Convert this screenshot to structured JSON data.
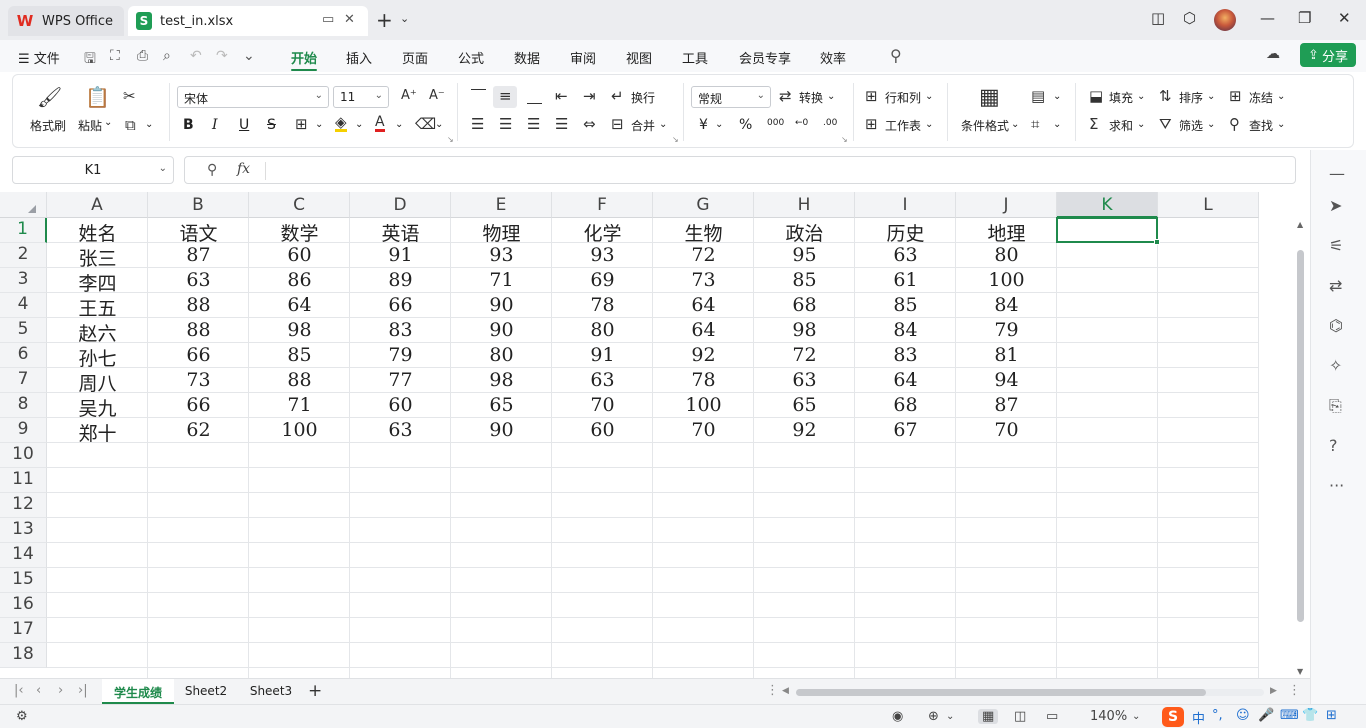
{
  "titlebar": {
    "home_tab_label": "WPS Office",
    "home_logo": "W",
    "file_tab_label": "test_in.xlsx",
    "file_logo": "S",
    "new_tab": "+",
    "icons": [
      "layout-icon",
      "cube-icon",
      "avatar",
      "minimize-icon",
      "restore-icon",
      "close-icon"
    ]
  },
  "menubar": {
    "file_menu": "☰ 文件",
    "tabs": [
      "开始",
      "插入",
      "页面",
      "公式",
      "数据",
      "审阅",
      "视图",
      "工具",
      "会员专享",
      "效率"
    ],
    "active_tab": "开始",
    "share": "分享"
  },
  "ribbon": {
    "format_painter": "格式刷",
    "paste": "粘贴",
    "font_name": "宋体",
    "font_size": "11",
    "bold": "B",
    "italic": "I",
    "underline": "U",
    "strike": "S",
    "wrap": "换行",
    "merge": "合并",
    "number_format": "常规",
    "convert": "转换",
    "currency": "¥",
    "percent": "%",
    "thousands": "000",
    "dec_increase": "←0",
    "dec_decrease": ".00",
    "rows_cols": "行和列",
    "worksheet": "工作表",
    "cond_format": "条件格式",
    "fill": "填充",
    "sort": "排序",
    "freeze": "冻结",
    "sum": "求和",
    "filter": "筛选",
    "find": "查找"
  },
  "formulabar": {
    "name_box": "K1",
    "fx": "fx",
    "formula": ""
  },
  "sheet": {
    "columns": [
      "A",
      "B",
      "C",
      "D",
      "E",
      "F",
      "G",
      "H",
      "I",
      "J",
      "K",
      "L"
    ],
    "selected_column": "K",
    "rows": [
      "1",
      "2",
      "3",
      "4",
      "5",
      "6",
      "7",
      "8",
      "9",
      "10",
      "11",
      "12",
      "13",
      "14",
      "15",
      "16",
      "17",
      "18"
    ],
    "selected_row": "1",
    "active_cell": "K1",
    "cells": [
      [
        "姓名",
        "语文",
        "数学",
        "英语",
        "物理",
        "化学",
        "生物",
        "政治",
        "历史",
        "地理"
      ],
      [
        "张三",
        "87",
        "60",
        "91",
        "93",
        "93",
        "72",
        "95",
        "63",
        "80"
      ],
      [
        "李四",
        "63",
        "86",
        "89",
        "71",
        "69",
        "73",
        "85",
        "61",
        "100"
      ],
      [
        "王五",
        "88",
        "64",
        "66",
        "90",
        "78",
        "64",
        "68",
        "85",
        "84"
      ],
      [
        "赵六",
        "88",
        "98",
        "83",
        "90",
        "80",
        "64",
        "98",
        "84",
        "79"
      ],
      [
        "孙七",
        "66",
        "85",
        "79",
        "80",
        "91",
        "92",
        "72",
        "83",
        "81"
      ],
      [
        "周八",
        "73",
        "88",
        "77",
        "98",
        "63",
        "78",
        "63",
        "64",
        "94"
      ],
      [
        "吴九",
        "66",
        "71",
        "60",
        "65",
        "70",
        "100",
        "65",
        "68",
        "87"
      ],
      [
        "郑十",
        "62",
        "100",
        "63",
        "90",
        "60",
        "70",
        "92",
        "67",
        "70"
      ]
    ]
  },
  "sheet_tabs": {
    "tabs": [
      "学生成绩",
      "Sheet2",
      "Sheet3"
    ],
    "active": "学生成绩",
    "add": "+"
  },
  "statusbar": {
    "zoom": "140%",
    "ime": [
      "中",
      "°,",
      "☺",
      "🎤",
      "⌨",
      "👕",
      "⊞"
    ]
  },
  "colors": {
    "accent": "#1f8a4c",
    "share_button": "#1f9d55",
    "wps_red": "#e02b20"
  }
}
